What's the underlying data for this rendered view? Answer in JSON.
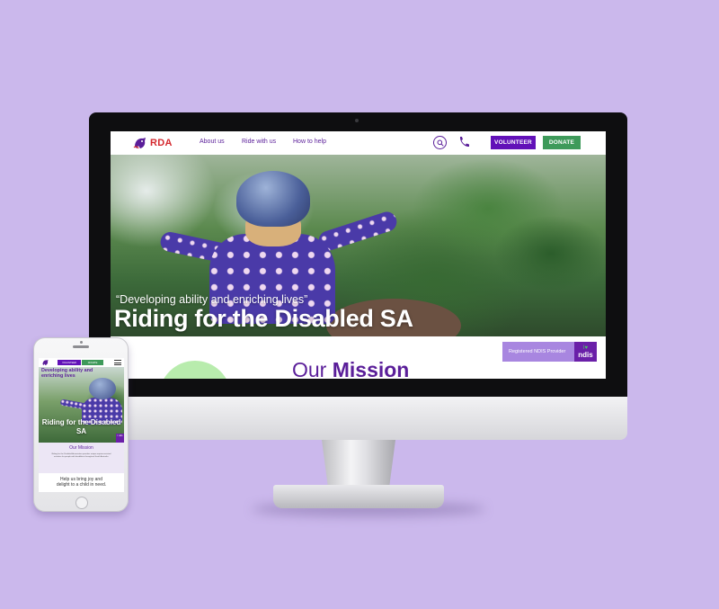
{
  "desktop": {
    "nav": {
      "logo_text": "RDA",
      "links": [
        "About us",
        "Ride with us",
        "How to help"
      ],
      "volunteer_label": "VOLUNTEER",
      "donate_label": "DONATE"
    },
    "hero": {
      "quote": "“Developing ability and enriching lives”",
      "title": "Riding for the Disabled SA"
    },
    "mission": {
      "title_light": "Our",
      "title_bold": "Mission",
      "ndis_badge_label": "Registered NDIS Provider",
      "ndis_logo_heart": "I",
      "ndis_logo_word": "ndis"
    }
  },
  "mobile": {
    "nav": {
      "volunteer_label": "VOLUNTEER",
      "donate_label": "DONATE"
    },
    "hero": {
      "tagline": "Developing ability and enriching lives",
      "title": "Riding for the Disabled SA",
      "ndis_label": "I ndis"
    },
    "mission": {
      "title": "Our Mission",
      "text": "Riding for the Disabled Association provides unique equine-assisted activities for people with disabilities throughout South Australia."
    },
    "help_text": "Help us bring joy and delight to a child in need."
  },
  "colors": {
    "background": "#cbb8ec",
    "brand_purple": "#5a1e99",
    "volunteer": "#6211b8",
    "donate": "#3e9a5a",
    "logo_red": "#d4282e",
    "ndis_badge": "#a886e0"
  },
  "icons": [
    "rda-logo-icon",
    "search-icon",
    "phone-icon",
    "menu-icon"
  ]
}
